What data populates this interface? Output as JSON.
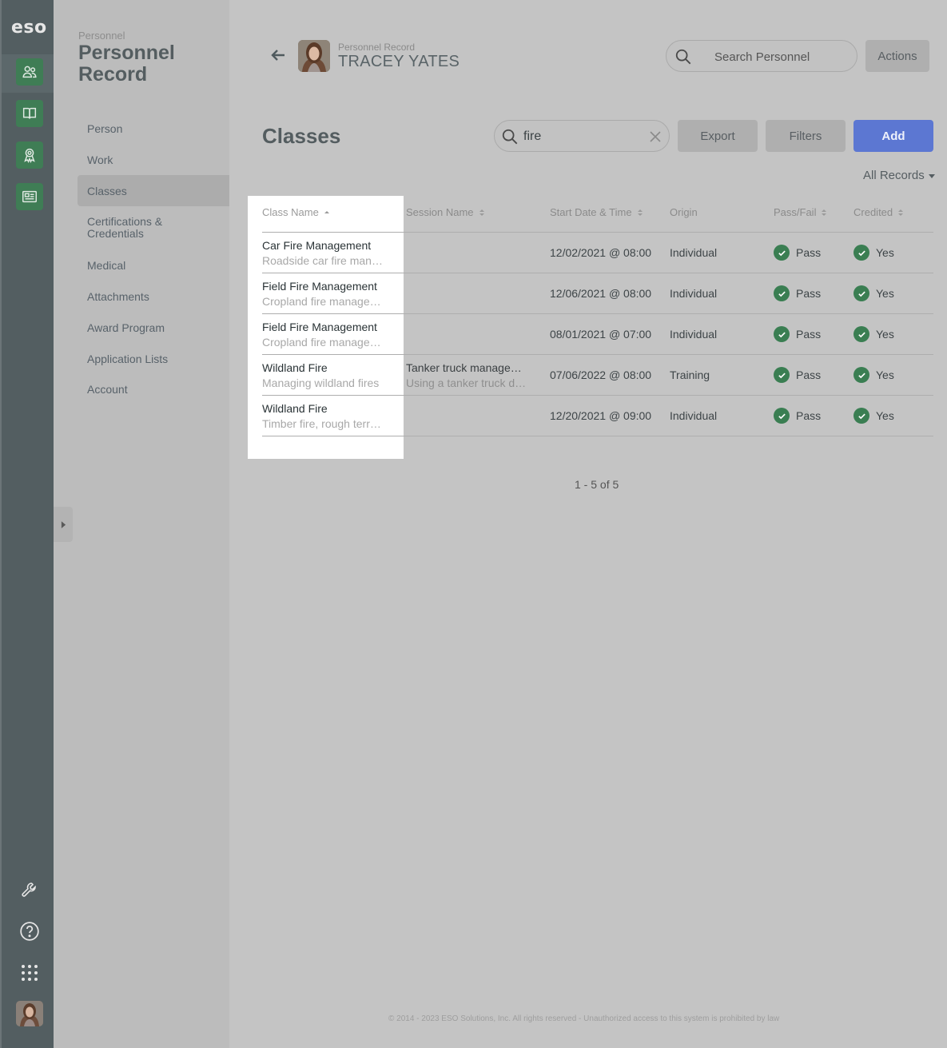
{
  "app": {
    "logo": "eso"
  },
  "subnav": {
    "crumb": "Personnel",
    "heading": "Personnel Record",
    "items": [
      {
        "label": "Person"
      },
      {
        "label": "Work"
      },
      {
        "label": "Classes"
      },
      {
        "label": "Certifications & Credentials"
      },
      {
        "label": "Medical"
      },
      {
        "label": "Attachments"
      },
      {
        "label": "Award Program"
      },
      {
        "label": "Application Lists"
      },
      {
        "label": "Account"
      }
    ]
  },
  "header": {
    "subtitle": "Personnel Record",
    "name": "TRACEY YATES",
    "search_placeholder": "Search Personnel",
    "actions_label": "Actions"
  },
  "classes": {
    "title": "Classes",
    "search_value": "fire",
    "export_label": "Export",
    "filters_label": "Filters",
    "add_label": "Add",
    "records_filter": "All Records",
    "columns": [
      "Class Name",
      "Session Name",
      "Start Date & Time",
      "Origin",
      "Pass/Fail",
      "Credited"
    ],
    "rows": [
      {
        "name": "Car Fire Management",
        "desc": "Roadside car fire man…",
        "session": "",
        "session_desc": "",
        "start": "12/02/2021 @ 08:00",
        "origin": "Individual",
        "pass": "Pass",
        "credited": "Yes"
      },
      {
        "name": "Field Fire Management",
        "desc": "Cropland fire manage…",
        "session": "",
        "session_desc": "",
        "start": "12/06/2021 @ 08:00",
        "origin": "Individual",
        "pass": "Pass",
        "credited": "Yes"
      },
      {
        "name": "Field Fire Management",
        "desc": "Cropland fire manage…",
        "session": "",
        "session_desc": "",
        "start": "08/01/2021 @ 07:00",
        "origin": "Individual",
        "pass": "Pass",
        "credited": "Yes"
      },
      {
        "name": "Wildland Fire",
        "desc": "Managing wildland fires",
        "session": "Tanker truck manage…",
        "session_desc": "Using a tanker truck d…",
        "start": "07/06/2022 @ 08:00",
        "origin": "Training",
        "pass": "Pass",
        "credited": "Yes"
      },
      {
        "name": "Wildland Fire",
        "desc": "Timber fire, rough terr…",
        "session": "",
        "session_desc": "",
        "start": "12/20/2021 @ 09:00",
        "origin": "Individual",
        "pass": "Pass",
        "credited": "Yes"
      }
    ],
    "pager": "1 - 5 of 5"
  },
  "footer": "© 2014 - 2023 ESO Solutions, Inc. All rights reserved - Unauthorized access to this system is prohibited by law",
  "colors": {
    "accent_green": "#3f7d55",
    "primary_blue": "#5c77d2",
    "rail": "#535e61"
  }
}
